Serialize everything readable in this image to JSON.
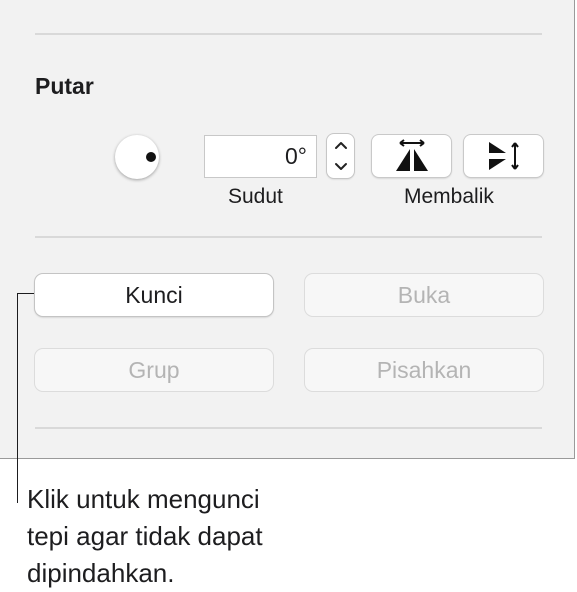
{
  "rotate": {
    "title": "Putar",
    "angle_value": "0°",
    "angle_label": "Sudut",
    "flip_label": "Membalik"
  },
  "actions": {
    "lock_label": "Kunci",
    "unlock_label": "Buka",
    "group_label": "Grup",
    "ungroup_label": "Pisahkan"
  },
  "callout": {
    "line1": "Klik untuk mengunci",
    "line2": "tepi agar tidak dapat",
    "line3": "dipindahkan."
  },
  "colors": {
    "panel_bg": "#f2f2f2",
    "disabled_text": "#b4b4b4"
  },
  "icons": {
    "rotate_dial": "rotation-dial-icon",
    "stepper_up": "chevron-up-icon",
    "stepper_down": "chevron-down-icon",
    "flip_horizontal": "flip-horizontal-icon",
    "flip_vertical": "flip-vertical-icon"
  }
}
